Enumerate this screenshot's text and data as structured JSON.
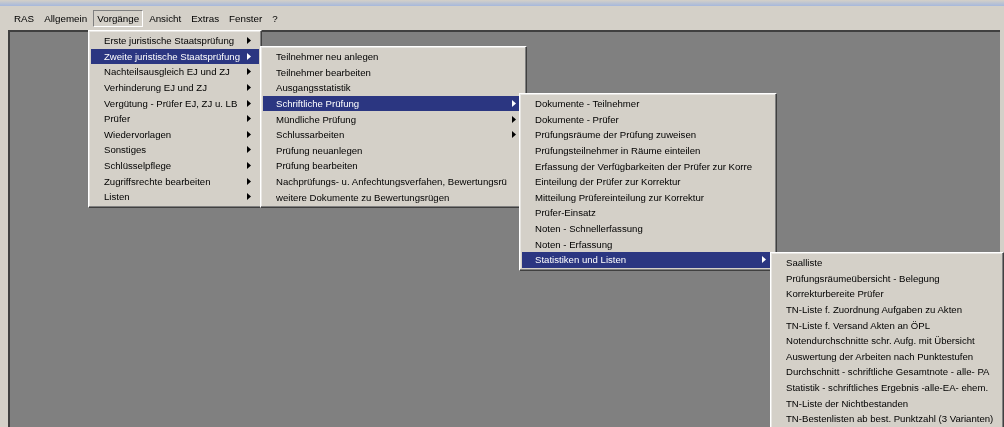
{
  "menu_bar": [
    {
      "label": "RAS",
      "selected": false
    },
    {
      "label": "Allgemein",
      "selected": false
    },
    {
      "label": "Vorgänge",
      "selected": true
    },
    {
      "label": "Ansicht",
      "selected": false
    },
    {
      "label": "Extras",
      "selected": false
    },
    {
      "label": "Fenster",
      "selected": false
    },
    {
      "label": "?",
      "selected": false
    }
  ],
  "menus": [
    {
      "items": [
        {
          "label": "Erste juristische Staatsprüfung",
          "has_submenu": true,
          "selected": false
        },
        {
          "label": "Zweite juristische Staatsprüfung",
          "has_submenu": true,
          "selected": true
        },
        {
          "label": "Nachteilsausgleich EJ und ZJ",
          "has_submenu": true,
          "selected": false
        },
        {
          "label": "Verhinderung EJ und ZJ",
          "has_submenu": true,
          "selected": false
        },
        {
          "label": "Vergütung - Prüfer EJ, ZJ u. LB",
          "has_submenu": true,
          "selected": false
        },
        {
          "label": "Prüfer",
          "has_submenu": true,
          "selected": false
        },
        {
          "label": "Wiedervorlagen",
          "has_submenu": true,
          "selected": false
        },
        {
          "label": "Sonstiges",
          "has_submenu": true,
          "selected": false
        },
        {
          "label": "Schlüsselpflege",
          "has_submenu": true,
          "selected": false
        },
        {
          "label": "Zugriffsrechte bearbeiten",
          "has_submenu": true,
          "selected": false
        },
        {
          "label": "Listen",
          "has_submenu": true,
          "selected": false
        }
      ]
    },
    {
      "items": [
        {
          "label": "Teilnehmer neu anlegen",
          "has_submenu": false,
          "selected": false
        },
        {
          "label": "Teilnehmer bearbeiten",
          "has_submenu": false,
          "selected": false
        },
        {
          "label": "Ausgangsstatistik",
          "has_submenu": false,
          "selected": false
        },
        {
          "label": "Schriftliche Prüfung",
          "has_submenu": true,
          "selected": true
        },
        {
          "label": "Mündliche Prüfung",
          "has_submenu": true,
          "selected": false
        },
        {
          "label": "Schlussarbeiten",
          "has_submenu": true,
          "selected": false
        },
        {
          "label": "Prüfung neuanlegen",
          "has_submenu": false,
          "selected": false
        },
        {
          "label": "Prüfung bearbeiten",
          "has_submenu": false,
          "selected": false
        },
        {
          "label": "Nachprüfungs- u. Anfechtungsverfahen, Bewertungsrü",
          "has_submenu": false,
          "selected": false
        },
        {
          "label": "weitere Dokumente zu Bewertungsrügen",
          "has_submenu": false,
          "selected": false
        }
      ]
    },
    {
      "items": [
        {
          "label": "Dokumente - Teilnehmer",
          "has_submenu": false,
          "selected": false
        },
        {
          "label": "Dokumente - Prüfer",
          "has_submenu": false,
          "selected": false
        },
        {
          "label": "Prüfungsräume der Prüfung zuweisen",
          "has_submenu": false,
          "selected": false
        },
        {
          "label": "Prüfungsteilnehmer in Räume einteilen",
          "has_submenu": false,
          "selected": false
        },
        {
          "label": "Erfassung der Verfügbarkeiten der Prüfer zur Korre",
          "has_submenu": false,
          "selected": false
        },
        {
          "label": "Einteilung der Prüfer zur Korrektur",
          "has_submenu": false,
          "selected": false
        },
        {
          "label": "Mitteilung Prüfereinteilung zur Korrektur",
          "has_submenu": false,
          "selected": false
        },
        {
          "label": "Prüfer-Einsatz",
          "has_submenu": false,
          "selected": false
        },
        {
          "label": "Noten - Schnellerfassung",
          "has_submenu": false,
          "selected": false
        },
        {
          "label": "Noten - Erfassung",
          "has_submenu": false,
          "selected": false
        },
        {
          "label": "Statistiken und Listen",
          "has_submenu": true,
          "selected": true
        }
      ]
    },
    {
      "items": [
        {
          "label": "Saalliste",
          "has_submenu": false,
          "selected": false
        },
        {
          "label": "Prüfungsräumeübersicht - Belegung",
          "has_submenu": false,
          "selected": false
        },
        {
          "label": "Korrekturbereite Prüfer",
          "has_submenu": false,
          "selected": false
        },
        {
          "label": "TN-Liste f. Zuordnung Aufgaben zu Akten",
          "has_submenu": false,
          "selected": false
        },
        {
          "label": "TN-Liste f. Versand Akten an ÖPL",
          "has_submenu": false,
          "selected": false
        },
        {
          "label": "Notendurchschnitte schr. Aufg. mit Übersicht",
          "has_submenu": false,
          "selected": false
        },
        {
          "label": "Auswertung der Arbeiten nach Punktestufen",
          "has_submenu": false,
          "selected": false
        },
        {
          "label": "Durchschnitt - schriftliche Gesamtnote - alle- PA",
          "has_submenu": false,
          "selected": false
        },
        {
          "label": "Statistik - schriftliches Ergebnis -alle-EA- ehem.",
          "has_submenu": false,
          "selected": false
        },
        {
          "label": "TN-Liste der Nichtbestanden",
          "has_submenu": false,
          "selected": false
        },
        {
          "label": "TN-Bestenlisten ab best. Punktzahl (3 Varianten)",
          "has_submenu": false,
          "selected": false
        }
      ]
    }
  ]
}
